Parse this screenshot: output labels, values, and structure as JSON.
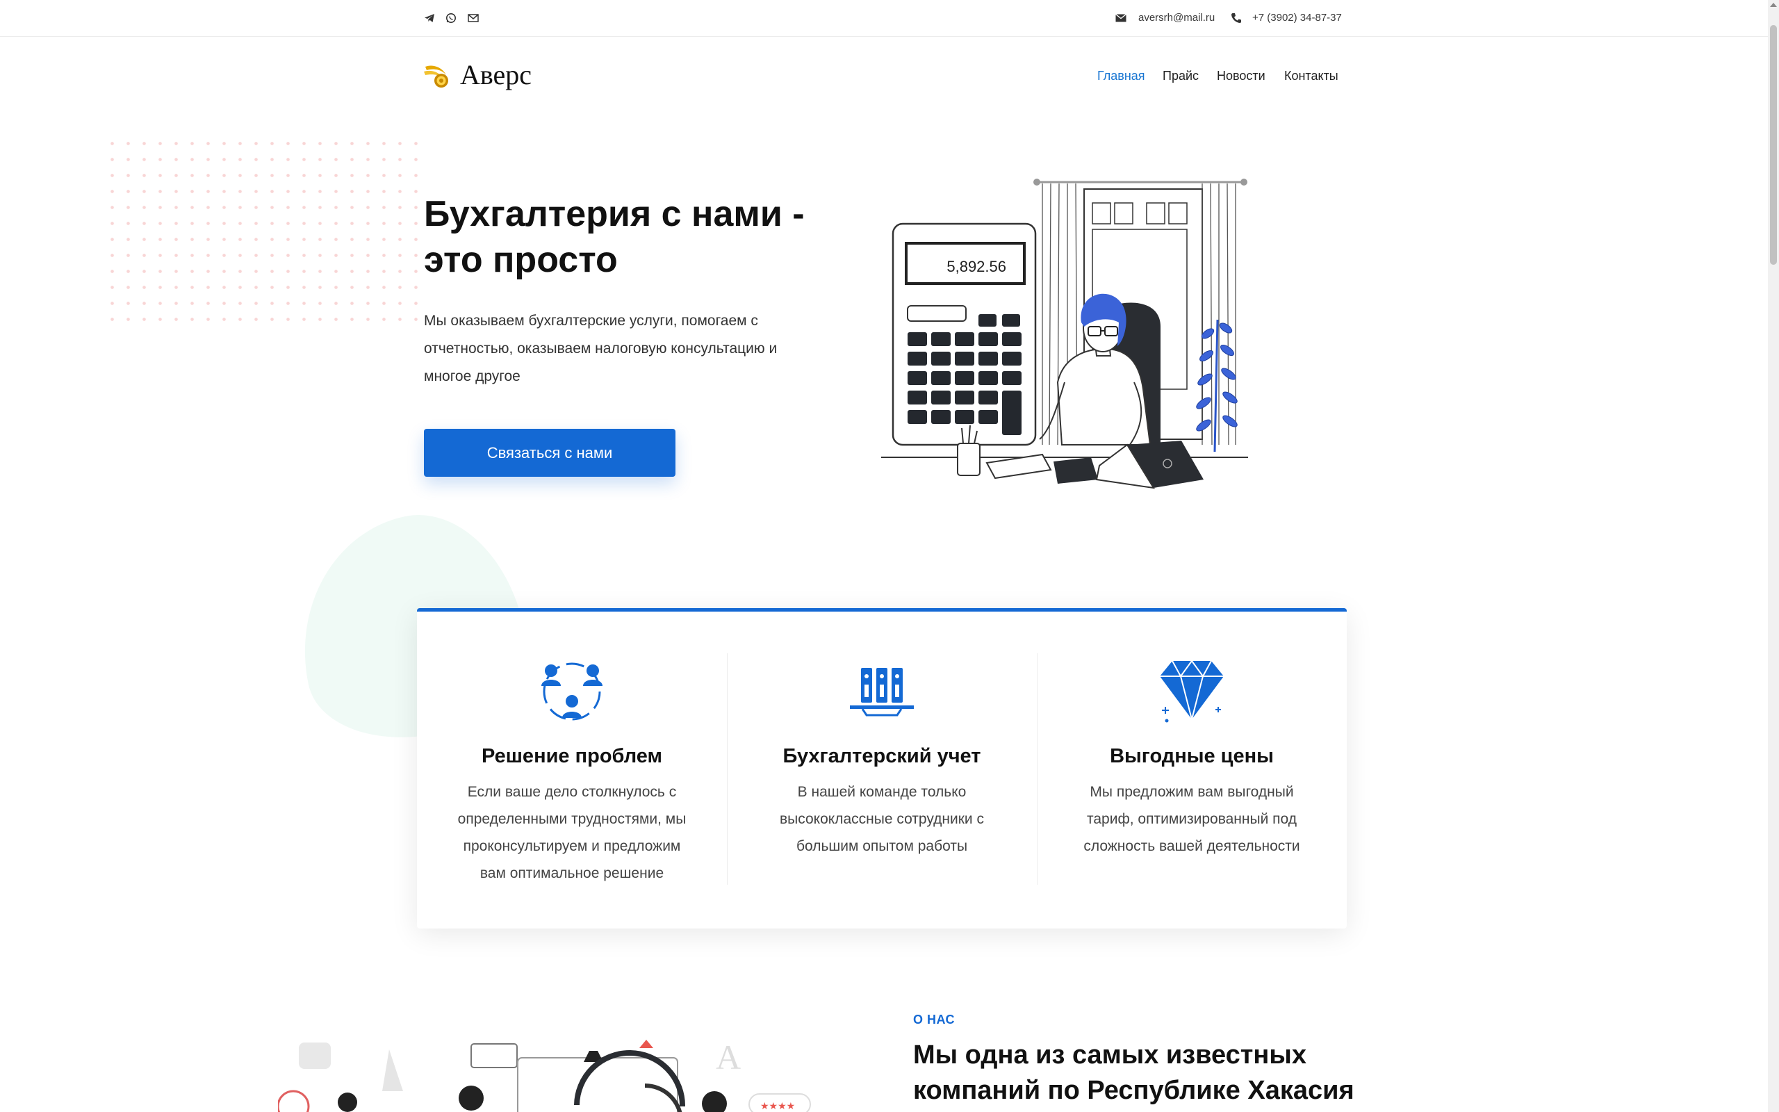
{
  "topbar": {
    "social_icons": [
      "telegram-icon",
      "whatsapp-icon",
      "email-icon"
    ],
    "email": "aversrh@mail.ru",
    "phone": "+7 (3902) 34-87-37"
  },
  "header": {
    "logo_text": "Аверс",
    "nav": [
      {
        "label": "Главная",
        "active": true
      },
      {
        "label": "Прайс",
        "active": false
      },
      {
        "label": "Новости",
        "active": false
      },
      {
        "label": "Контакты",
        "active": false
      }
    ]
  },
  "hero": {
    "title": "Бухгалтерия с нами - это просто",
    "description": "Мы оказываем бухгалтерские услуги, помогаем с отчетностью, оказываем налоговую консультацию и многое другое",
    "cta_label": "Связаться с нами",
    "calculator_display": "5,892.56"
  },
  "features": [
    {
      "icon": "team-icon",
      "title": "Решение проблем",
      "text": "Если ваше дело столкнулось с определенными трудностями, мы проконсультируем и предложим вам оптимальное решение"
    },
    {
      "icon": "binders-icon",
      "title": "Бухгалтерский учет",
      "text": "В нашей команде только высококлассные сотрудники с большим опытом работы"
    },
    {
      "icon": "diamond-icon",
      "title": "Выгодные цены",
      "text": "Мы предложим вам выгодный тариф, оптимизированный под сложность вашей деятельности"
    }
  ],
  "about": {
    "label": "О НАС",
    "title": "Мы одна из самых известных компаний по Республике Хакасия"
  },
  "colors": {
    "accent": "#1469d4",
    "text": "#111111"
  }
}
